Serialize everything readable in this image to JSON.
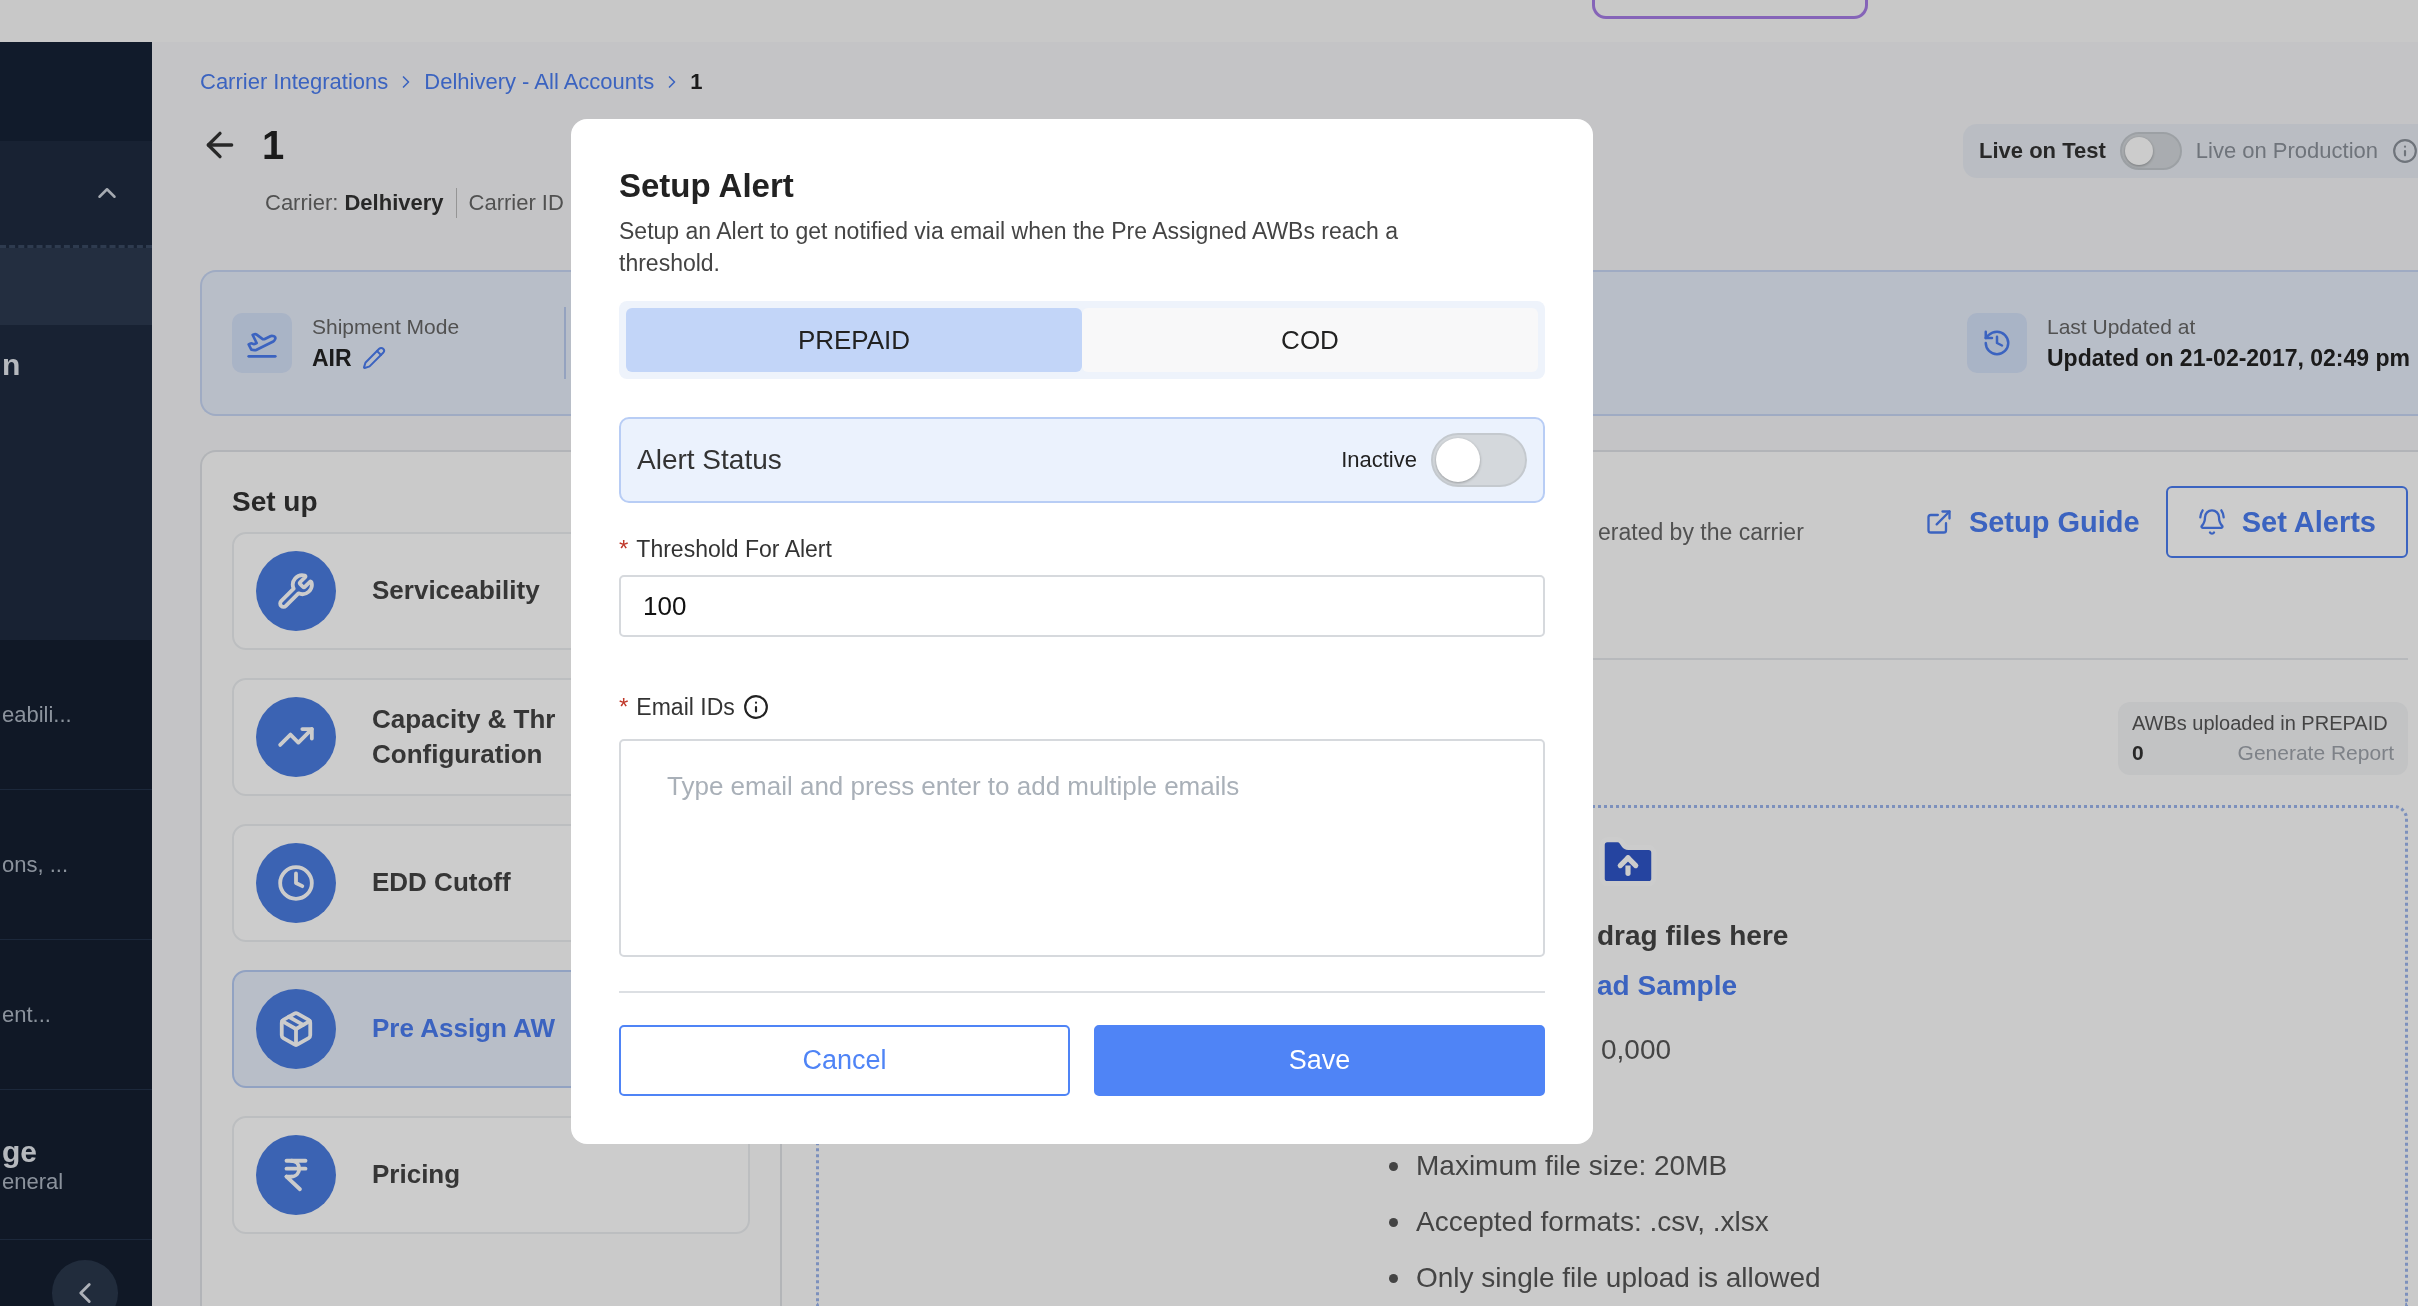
{
  "sidebar": {
    "group_expanded": true,
    "items": [
      {
        "selected": true
      },
      {
        "title": "n",
        "selected": false
      },
      {
        "subtitle": "eabili...",
        "selected": false
      },
      {
        "subtitle": "ons, ...",
        "selected": false
      },
      {
        "subtitle": "ent...",
        "selected": false
      },
      {
        "title": "ge",
        "subtitle": "eneral",
        "selected": false
      }
    ]
  },
  "breadcrumbs": [
    {
      "label": "Carrier Integrations",
      "link": true
    },
    {
      "label": "Delhivery - All Accounts",
      "link": true
    },
    {
      "label": "1",
      "link": false
    }
  ],
  "page": {
    "title": "1",
    "carrier_label": "Carrier:",
    "carrier_name": "Delhivery",
    "carrier_id_label": "Carrier ID"
  },
  "environment": {
    "test_label": "Live on Test",
    "production_label": "Live on Production",
    "on": false
  },
  "summary": {
    "shipment_mode_label": "Shipment Mode",
    "shipment_mode": "AIR",
    "last_updated_label": "Last Updated at",
    "last_updated": "Updated on 21-02-2017, 02:49 pm"
  },
  "setup": {
    "title": "Set up",
    "items": [
      {
        "kind": "serviceability",
        "lines": [
          "Serviceability"
        ],
        "selected": false
      },
      {
        "kind": "capacity",
        "lines": [
          "Capacity & Thr",
          "Configuration"
        ],
        "selected": false
      },
      {
        "kind": "cutoff",
        "lines": [
          "EDD Cutoff"
        ],
        "selected": false
      },
      {
        "kind": "awb",
        "lines": [
          "Pre Assign AW"
        ],
        "selected": true
      },
      {
        "kind": "pricing",
        "lines": [
          "Pricing"
        ],
        "selected": false
      }
    ]
  },
  "panel": {
    "description": "erated by the carrier",
    "setup_guide": "Setup Guide",
    "set_alerts": "Set Alerts",
    "uploaded_label": "AWBs uploaded in PREPAID",
    "uploaded_count": "0",
    "generate_report": "Generate Report",
    "generate_report_disabled": true,
    "upload": {
      "prompt": "drag files here",
      "sample_link": "ad Sample",
      "rows_limit": "0,000",
      "rules": [
        "Maximum file size: 20MB",
        "Accepted formats: .csv, .xlsx",
        "Only single file upload is allowed"
      ]
    }
  },
  "modal": {
    "title": "Setup Alert",
    "description": "Setup an Alert to get notified via email when the Pre Assigned AWBs reach a threshold.",
    "tabs": [
      {
        "label": "PREPAID",
        "selected": true
      },
      {
        "label": "COD",
        "selected": false
      }
    ],
    "status_label": "Alert Status",
    "status_text": "Inactive",
    "active": false,
    "fields": [
      {
        "kind": "input",
        "required_mark": "*",
        "label": "Threshold For Alert",
        "value": "100"
      },
      {
        "kind": "textarea",
        "required_mark": "*",
        "label": "Email IDs",
        "info": true,
        "placeholder": "Type email and press enter to add multiple emails"
      }
    ],
    "cancel": "Cancel",
    "save": "Save"
  }
}
